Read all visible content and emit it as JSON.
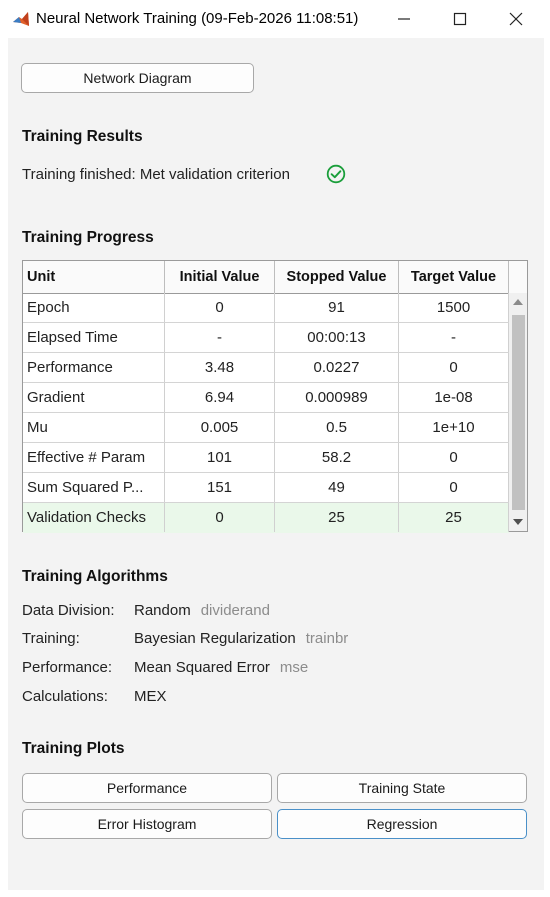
{
  "window": {
    "title": "Neural Network Training (09-Feb-2026 11:08:51)",
    "app_icon": "matlab-icon"
  },
  "buttons": {
    "network_diagram": "Network Diagram"
  },
  "training_results": {
    "heading": "Training Results",
    "status": "Training finished: Met validation criterion",
    "status_icon": "check-circle-icon",
    "status_color": "#1a9e3a"
  },
  "training_progress": {
    "heading": "Training Progress",
    "columns": [
      "Unit",
      "Initial Value",
      "Stopped Value",
      "Target Value"
    ],
    "rows": [
      {
        "unit": "Epoch",
        "initial": "0",
        "stopped": "91",
        "target": "1500"
      },
      {
        "unit": "Elapsed Time",
        "initial": "-",
        "stopped": "00:00:13",
        "target": "-"
      },
      {
        "unit": "Performance",
        "initial": "3.48",
        "stopped": "0.0227",
        "target": "0"
      },
      {
        "unit": "Gradient",
        "initial": "6.94",
        "stopped": "0.000989",
        "target": "1e-08"
      },
      {
        "unit": "Mu",
        "initial": "0.005",
        "stopped": "0.5",
        "target": "1e+10"
      },
      {
        "unit": "Effective # Param",
        "initial": "101",
        "stopped": "58.2",
        "target": "0"
      },
      {
        "unit": "Sum Squared P...",
        "initial": "151",
        "stopped": "49",
        "target": "0"
      },
      {
        "unit": "Validation Checks",
        "initial": "0",
        "stopped": "25",
        "target": "25"
      }
    ],
    "highlight_color": "#eaf8ea"
  },
  "training_algorithms": {
    "heading": "Training Algorithms",
    "items": [
      {
        "label": "Data Division:",
        "value": "Random",
        "func": "dividerand"
      },
      {
        "label": "Training:",
        "value": "Bayesian Regularization",
        "func": "trainbr"
      },
      {
        "label": "Performance:",
        "value": "Mean Squared Error",
        "func": "mse"
      },
      {
        "label": "Calculations:",
        "value": "MEX",
        "func": ""
      }
    ]
  },
  "training_plots": {
    "heading": "Training Plots",
    "buttons": [
      "Performance",
      "Training State",
      "Error Histogram",
      "Regression"
    ]
  }
}
